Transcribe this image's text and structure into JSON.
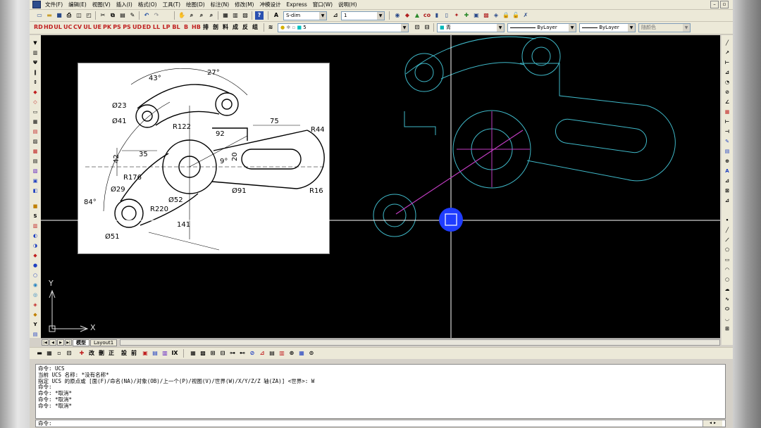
{
  "menu": [
    "文件(F)",
    "编辑(E)",
    "视图(V)",
    "插入(I)",
    "格式(O)",
    "工具(T)",
    "绘图(D)",
    "标注(N)",
    "修改(M)",
    "冲模设计",
    "Express",
    "窗口(W)",
    "说明(H)"
  ],
  "toolbar_std": {
    "text_style": "S-dim",
    "dim_style": "1"
  },
  "toolbar_props": {
    "layer": "5",
    "color": "青",
    "linetype": "ByLayer",
    "lineweight": "ByLayer",
    "plotstyle": "随颜色"
  },
  "tabs": [
    "模型",
    "Layout1"
  ],
  "ucs": {
    "x": "X",
    "y": "Y"
  },
  "command_history": [
    "命令: UCS",
    "当前 UCS 名称: *没有名称*",
    "指定 UCS 的原点或 [面(F)/命名(NA)/对象(OB)/上一个(P)/视图(V)/世界(W)/X/Y/Z/Z 轴(ZA)] <世界>: W",
    "命令:",
    "命令: *取消*",
    "命令: *取消*",
    "命令: *取消*"
  ],
  "command_prompt": "命令:",
  "reference_labels": {
    "a43": "43°",
    "a27": "27°",
    "d23": "Ø23",
    "d41": "Ø41",
    "r122": "R122",
    "d92": "92",
    "d75": "75",
    "r44": "R44",
    "d42": "42",
    "d35": "35",
    "a9": "9°",
    "d20": "20",
    "r176": "R176",
    "d29": "Ø29",
    "a84": "84°",
    "r220": "R220",
    "d52": "Ø52",
    "d91": "Ø91",
    "r16": "R16",
    "d51": "Ø51",
    "d141": "141"
  },
  "colors": {
    "canvas": "#000000",
    "geometry": "#3fb8c8",
    "crosshair": "#ffffff",
    "accent_line": "#c03cc0",
    "cursor": "#1f3cff"
  }
}
